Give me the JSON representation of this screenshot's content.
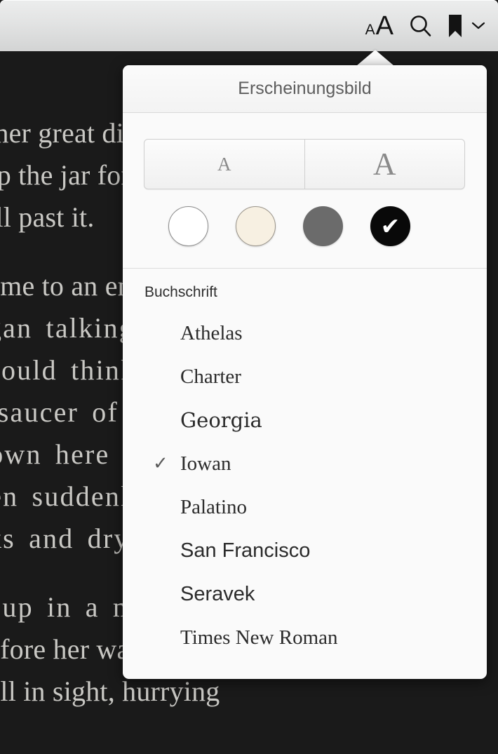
{
  "reader": {
    "background_color": "#1a1a1a",
    "text_color": "#c9c8c4",
    "lines": [
      "o her great disappointment it was",
      "rop the jar for fear of killing some",
      "fell past it.",
      "come to an end! I wonder if I shall",
      "egan talking again. “Dinah’ll miss me",
      "should think!” (Dinah was the cat.)",
      "r saucer of milk at tea-time. Dinah",
      " down here with me! There are no",
      "hen suddenly, thump! thump! down",
      "cks and dry leaves, and the fall was",
      "d up in a moment: she looked up, but",
      "before her was another",
      "still in sight, hurrying"
    ]
  },
  "toolbar": {
    "font_size_button": {
      "small_label": "A",
      "large_label": "A",
      "icon": "font-size-icon"
    },
    "search_button": {
      "icon": "search-icon"
    },
    "bookmark_button": {
      "icon": "bookmark-icon"
    },
    "bookmark_chevron": {
      "icon": "chevron-down-icon"
    }
  },
  "popover": {
    "title": "Erscheinungsbild",
    "size_control": {
      "options": [
        {
          "label": "A",
          "name": "decrease-font-size"
        },
        {
          "label": "A",
          "name": "increase-font-size"
        }
      ]
    },
    "themes": [
      {
        "name": "white",
        "color": "#ffffff",
        "selected": false,
        "check": ""
      },
      {
        "name": "sepia",
        "color": "#f7f0e2",
        "selected": false,
        "check": ""
      },
      {
        "name": "gray",
        "color": "#6b6b6b",
        "selected": false,
        "check": ""
      },
      {
        "name": "black",
        "color": "#090909",
        "selected": true,
        "check": "✔"
      }
    ],
    "font_section_label": "Buchschrift",
    "fonts": [
      {
        "label": "Athelas",
        "selected": false,
        "check": ""
      },
      {
        "label": "Charter",
        "selected": false,
        "check": ""
      },
      {
        "label": "Georgia",
        "selected": false,
        "check": ""
      },
      {
        "label": "Iowan",
        "selected": true,
        "check": "✓"
      },
      {
        "label": "Palatino",
        "selected": false,
        "check": ""
      },
      {
        "label": "San Francisco",
        "selected": false,
        "check": ""
      },
      {
        "label": "Seravek",
        "selected": false,
        "check": ""
      },
      {
        "label": "Times New Roman",
        "selected": false,
        "check": ""
      }
    ]
  }
}
